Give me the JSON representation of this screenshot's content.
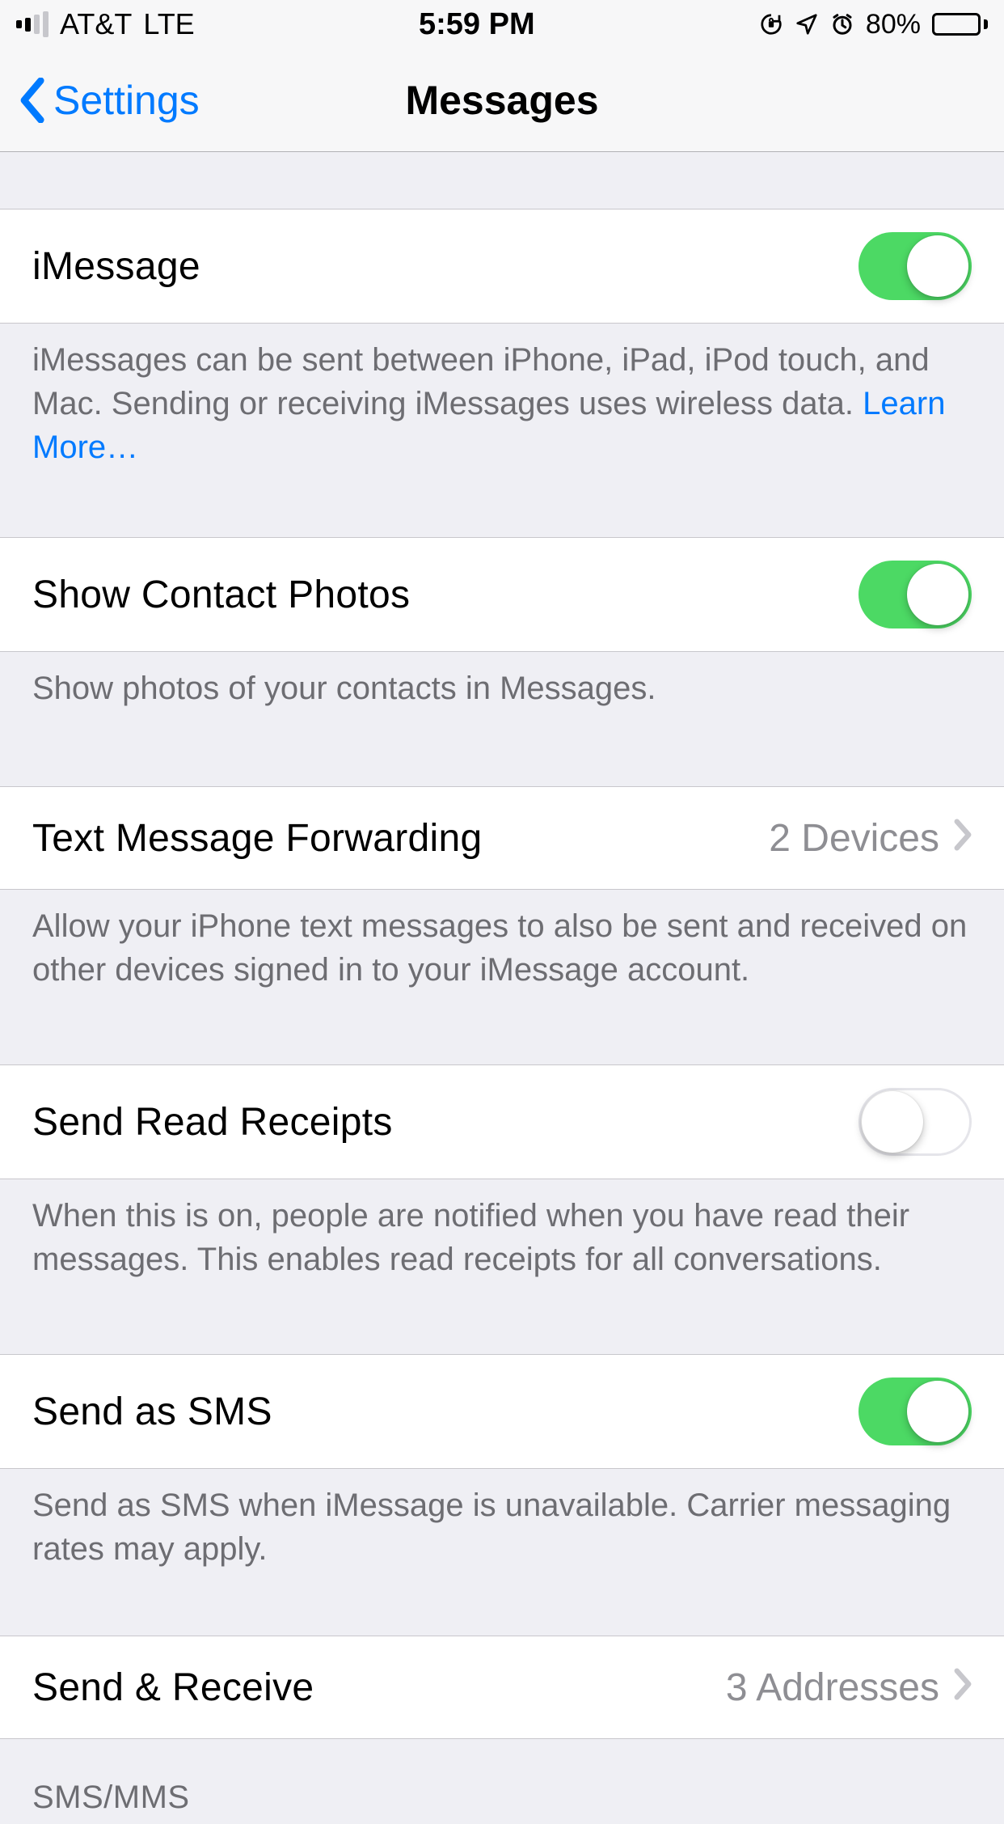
{
  "status": {
    "carrier": "AT&T",
    "network": "LTE",
    "time": "5:59 PM",
    "battery_pct": "80%"
  },
  "nav": {
    "back_label": "Settings",
    "title": "Messages"
  },
  "rows": {
    "imessage": {
      "label": "iMessage",
      "footer": "iMessages can be sent between iPhone, iPad, iPod touch, and Mac. Sending or receiving iMessages uses wireless data.",
      "learn_more": "Learn More…",
      "on": true
    },
    "contact_photos": {
      "label": "Show Contact Photos",
      "footer": "Show photos of your contacts in Messages.",
      "on": true
    },
    "forwarding": {
      "label": "Text Message Forwarding",
      "value": "2 Devices",
      "footer": "Allow your iPhone text messages to also be sent and received on other devices signed in to your iMessage account."
    },
    "read_receipts": {
      "label": "Send Read Receipts",
      "footer": "When this is on, people are notified when you have read their messages. This enables read receipts for all conversations.",
      "on": false
    },
    "send_sms": {
      "label": "Send as SMS",
      "footer": "Send as SMS when iMessage is unavailable. Carrier messaging rates may apply.",
      "on": true
    },
    "send_receive": {
      "label": "Send & Receive",
      "value": "3 Addresses"
    }
  },
  "section": {
    "sms_mms": "SMS/MMS"
  }
}
